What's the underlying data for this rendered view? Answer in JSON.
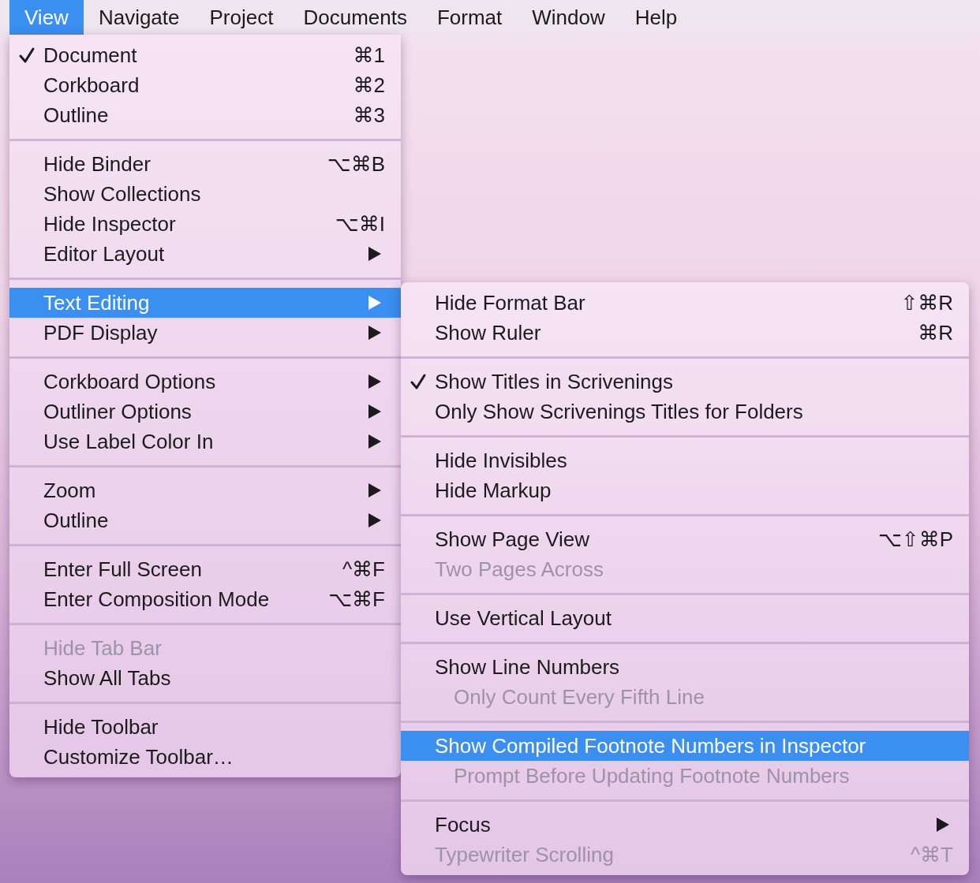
{
  "menu_bar": [
    {
      "label": "View",
      "selected": true
    },
    {
      "label": "Navigate",
      "selected": false
    },
    {
      "label": "Project",
      "selected": false
    },
    {
      "label": "Documents",
      "selected": false
    },
    {
      "label": "Format",
      "selected": false
    },
    {
      "label": "Window",
      "selected": false
    },
    {
      "label": "Help",
      "selected": false
    }
  ],
  "view_menu": {
    "groups": [
      {
        "items": [
          {
            "label": "Document",
            "shortcut": "⌘1",
            "checked": true,
            "disabled": false,
            "selected": false,
            "has_submenu": false
          },
          {
            "label": "Corkboard",
            "shortcut": "⌘2",
            "checked": false,
            "disabled": false,
            "selected": false,
            "has_submenu": false
          },
          {
            "label": "Outline",
            "shortcut": "⌘3",
            "checked": false,
            "disabled": false,
            "selected": false,
            "has_submenu": false
          }
        ]
      },
      {
        "items": [
          {
            "label": "Hide Binder",
            "shortcut": "⌥⌘B",
            "checked": false,
            "disabled": false,
            "selected": false,
            "has_submenu": false
          },
          {
            "label": "Show Collections",
            "checked": false,
            "disabled": false,
            "selected": false,
            "has_submenu": false
          },
          {
            "label": "Hide Inspector",
            "shortcut": "⌥⌘I",
            "checked": false,
            "disabled": false,
            "selected": false,
            "has_submenu": false
          },
          {
            "label": "Editor Layout",
            "checked": false,
            "disabled": false,
            "selected": false,
            "has_submenu": true
          }
        ]
      },
      {
        "items": [
          {
            "label": "Text Editing",
            "checked": false,
            "disabled": false,
            "selected": true,
            "has_submenu": true
          },
          {
            "label": "PDF Display",
            "checked": false,
            "disabled": false,
            "selected": false,
            "has_submenu": true
          }
        ]
      },
      {
        "items": [
          {
            "label": "Corkboard Options",
            "checked": false,
            "disabled": false,
            "selected": false,
            "has_submenu": true
          },
          {
            "label": "Outliner Options",
            "checked": false,
            "disabled": false,
            "selected": false,
            "has_submenu": true
          },
          {
            "label": "Use Label Color In",
            "checked": false,
            "disabled": false,
            "selected": false,
            "has_submenu": true
          }
        ]
      },
      {
        "items": [
          {
            "label": "Zoom",
            "checked": false,
            "disabled": false,
            "selected": false,
            "has_submenu": true
          },
          {
            "label": "Outline",
            "checked": false,
            "disabled": false,
            "selected": false,
            "has_submenu": true
          }
        ]
      },
      {
        "items": [
          {
            "label": "Enter Full Screen",
            "shortcut": "^⌘F",
            "checked": false,
            "disabled": false,
            "selected": false,
            "has_submenu": false
          },
          {
            "label": "Enter Composition Mode",
            "shortcut": "⌥⌘F",
            "checked": false,
            "disabled": false,
            "selected": false,
            "has_submenu": false
          }
        ]
      },
      {
        "items": [
          {
            "label": "Hide Tab Bar",
            "checked": false,
            "disabled": true,
            "selected": false,
            "has_submenu": false
          },
          {
            "label": "Show All Tabs",
            "checked": false,
            "disabled": false,
            "selected": false,
            "has_submenu": false
          }
        ]
      },
      {
        "items": [
          {
            "label": "Hide Toolbar",
            "checked": false,
            "disabled": false,
            "selected": false,
            "has_submenu": false
          },
          {
            "label": "Customize Toolbar…",
            "checked": false,
            "disabled": false,
            "selected": false,
            "has_submenu": false
          }
        ]
      }
    ]
  },
  "text_editing_submenu": {
    "groups": [
      {
        "items": [
          {
            "label": "Hide Format Bar",
            "shortcut": "⇧⌘R",
            "checked": false,
            "disabled": false,
            "selected": false,
            "has_submenu": false
          },
          {
            "label": "Show Ruler",
            "shortcut": "⌘R",
            "checked": false,
            "disabled": false,
            "selected": false,
            "has_submenu": false
          }
        ]
      },
      {
        "items": [
          {
            "label": "Show Titles in Scrivenings",
            "checked": true,
            "disabled": false,
            "selected": false,
            "has_submenu": false
          },
          {
            "label": "Only Show Scrivenings Titles for Folders",
            "checked": false,
            "disabled": false,
            "selected": false,
            "has_submenu": false
          }
        ]
      },
      {
        "items": [
          {
            "label": "Hide Invisibles",
            "checked": false,
            "disabled": false,
            "selected": false,
            "has_submenu": false
          },
          {
            "label": "Hide Markup",
            "checked": false,
            "disabled": false,
            "selected": false,
            "has_submenu": false
          }
        ]
      },
      {
        "items": [
          {
            "label": "Show Page View",
            "shortcut": "⌥⇧⌘P",
            "checked": false,
            "disabled": false,
            "selected": false,
            "has_submenu": false
          },
          {
            "label": "Two Pages Across",
            "checked": false,
            "disabled": true,
            "selected": false,
            "has_submenu": false
          }
        ]
      },
      {
        "items": [
          {
            "label": "Use Vertical Layout",
            "checked": false,
            "disabled": false,
            "selected": false,
            "has_submenu": false
          }
        ]
      },
      {
        "items": [
          {
            "label": "Show Line Numbers",
            "checked": false,
            "disabled": false,
            "selected": false,
            "has_submenu": false,
            "children": [
              {
                "label": "Only Count Every Fifth Line",
                "checked": false,
                "disabled": true,
                "selected": false,
                "has_submenu": false
              }
            ]
          }
        ]
      },
      {
        "items": [
          {
            "label": "Show Compiled Footnote Numbers in Inspector",
            "checked": false,
            "disabled": false,
            "selected": true,
            "has_submenu": false,
            "children": [
              {
                "label": "Prompt Before Updating Footnote Numbers",
                "checked": false,
                "disabled": true,
                "selected": false,
                "has_submenu": false
              }
            ]
          }
        ]
      },
      {
        "items": [
          {
            "label": "Focus",
            "checked": false,
            "disabled": false,
            "selected": false,
            "has_submenu": true
          },
          {
            "label": "Typewriter Scrolling",
            "shortcut": "^⌘T",
            "checked": false,
            "disabled": true,
            "selected": false,
            "has_submenu": false
          }
        ]
      }
    ]
  }
}
